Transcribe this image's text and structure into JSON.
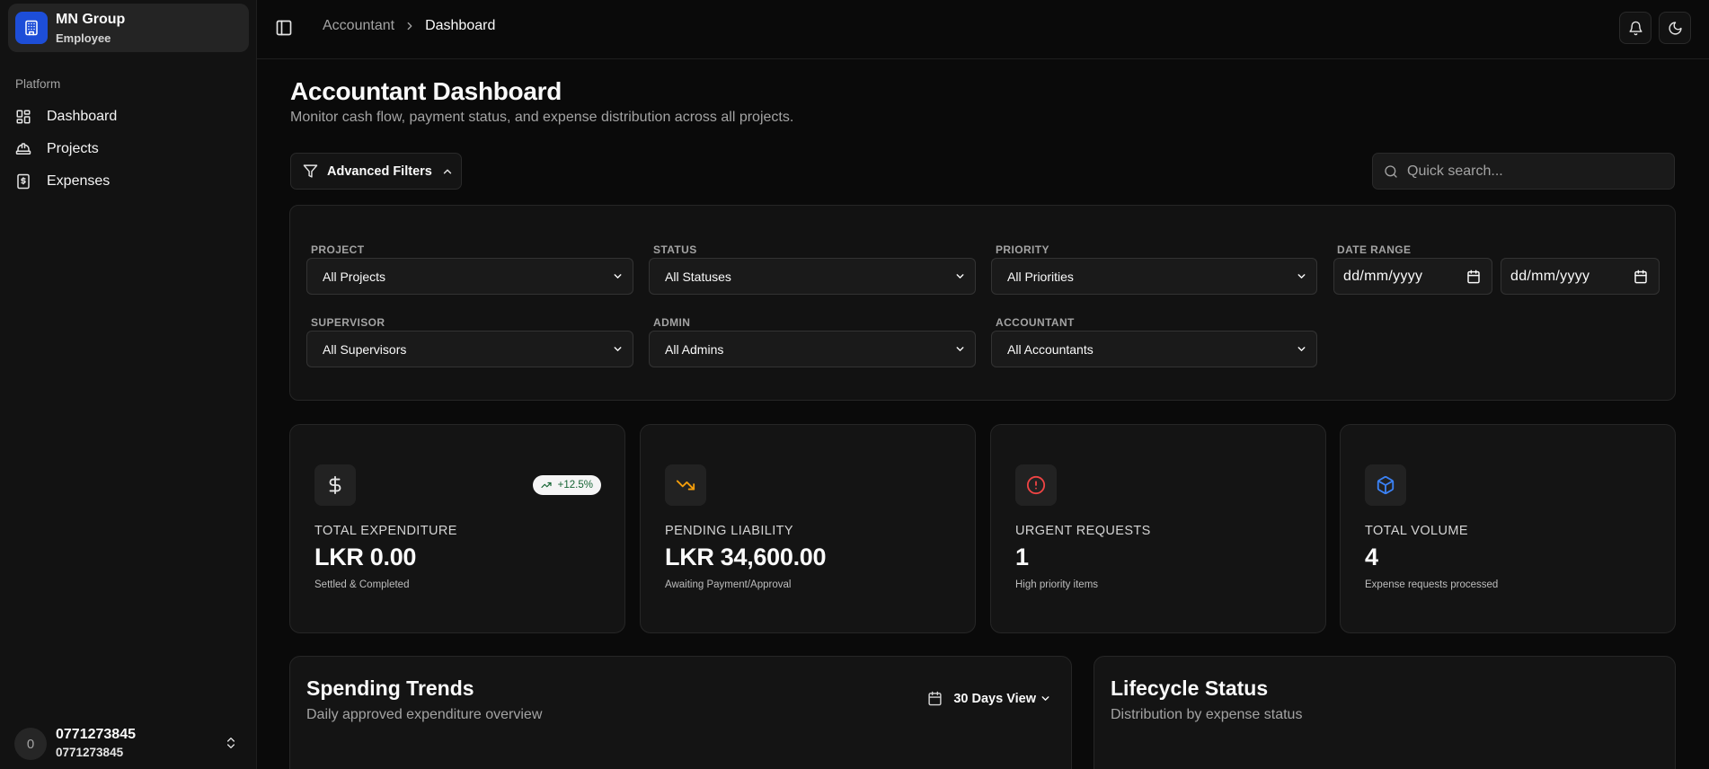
{
  "sidebar": {
    "org_name": "MN Group",
    "org_role": "Employee",
    "section_label": "Platform",
    "items": [
      {
        "label": "Dashboard",
        "icon": "layout-grid-icon"
      },
      {
        "label": "Projects",
        "icon": "hard-hat-icon"
      },
      {
        "label": "Expenses",
        "icon": "receipt-icon"
      }
    ],
    "user": {
      "avatar_initial": "0",
      "name": "0771273845",
      "sub": "0771273845"
    }
  },
  "header": {
    "breadcrumb": {
      "parent": "Accountant",
      "current": "Dashboard"
    }
  },
  "page": {
    "title": "Accountant Dashboard",
    "subtitle": "Monitor cash flow, payment status, and expense distribution across all projects."
  },
  "toolbar": {
    "advanced_filters_label": "Advanced Filters",
    "search_placeholder": "Quick search..."
  },
  "filters": {
    "project": {
      "label": "PROJECT",
      "value": "All Projects"
    },
    "status": {
      "label": "STATUS",
      "value": "All Statuses"
    },
    "priority": {
      "label": "PRIORITY",
      "value": "All Priorities"
    },
    "date_range": {
      "label": "DATE RANGE",
      "from": "dd/mm/yyyy",
      "to": "dd/mm/yyyy"
    },
    "supervisor": {
      "label": "SUPERVISOR",
      "value": "All Supervisors"
    },
    "admin": {
      "label": "ADMIN",
      "value": "All Admins"
    },
    "accountant": {
      "label": "ACCOUNTANT",
      "value": "All Accountants"
    }
  },
  "stats": [
    {
      "label": "TOTAL EXPENDITURE",
      "value": "LKR 0.00",
      "note": "Settled & Completed",
      "badge": "+12.5%",
      "icon": "dollar-icon",
      "color": "#e5e5e5"
    },
    {
      "label": "PENDING LIABILITY",
      "value": "LKR 34,600.00",
      "note": "Awaiting Payment/Approval",
      "icon": "trending-down-icon",
      "color": "#f59e0b"
    },
    {
      "label": "URGENT REQUESTS",
      "value": "1",
      "note": "High priority items",
      "icon": "alert-circle-icon",
      "color": "#ef4444"
    },
    {
      "label": "TOTAL VOLUME",
      "value": "4",
      "note": "Expense requests processed",
      "icon": "box-icon",
      "color": "#3b82f6"
    }
  ],
  "panels": {
    "spending": {
      "title": "Spending Trends",
      "subtitle": "Daily approved expenditure overview",
      "view_label": "30 Days View"
    },
    "lifecycle": {
      "title": "Lifecycle Status",
      "subtitle": "Distribution by expense status"
    }
  }
}
